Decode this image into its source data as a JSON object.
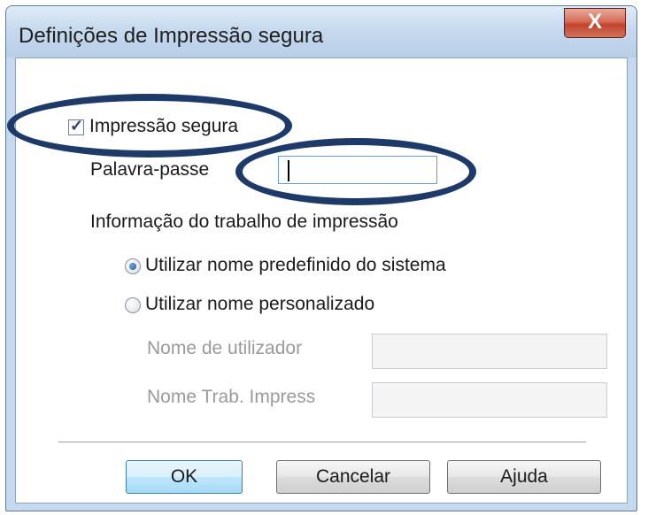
{
  "window": {
    "title": "Definições de Impressão segura",
    "close_label": "X"
  },
  "secure_print": {
    "label": "Impressão segura",
    "checked": true
  },
  "password": {
    "label": "Palavra-passe",
    "value": ""
  },
  "job_info": {
    "heading": "Informação do trabalho de impressão",
    "options": [
      {
        "label": "Utilizar nome predefinido do sistema",
        "selected": true
      },
      {
        "label": "Utilizar nome personalizado",
        "selected": false
      }
    ],
    "username_label": "Nome de utilizador",
    "jobname_label": "Nome Trab. Impress"
  },
  "buttons": {
    "ok": "OK",
    "cancel": "Cancelar",
    "help": "Ajuda"
  },
  "colors": {
    "highlight_ellipse": "#1e3a68",
    "title_bar": "#c6d9ee",
    "close_button": "#c1442c"
  }
}
